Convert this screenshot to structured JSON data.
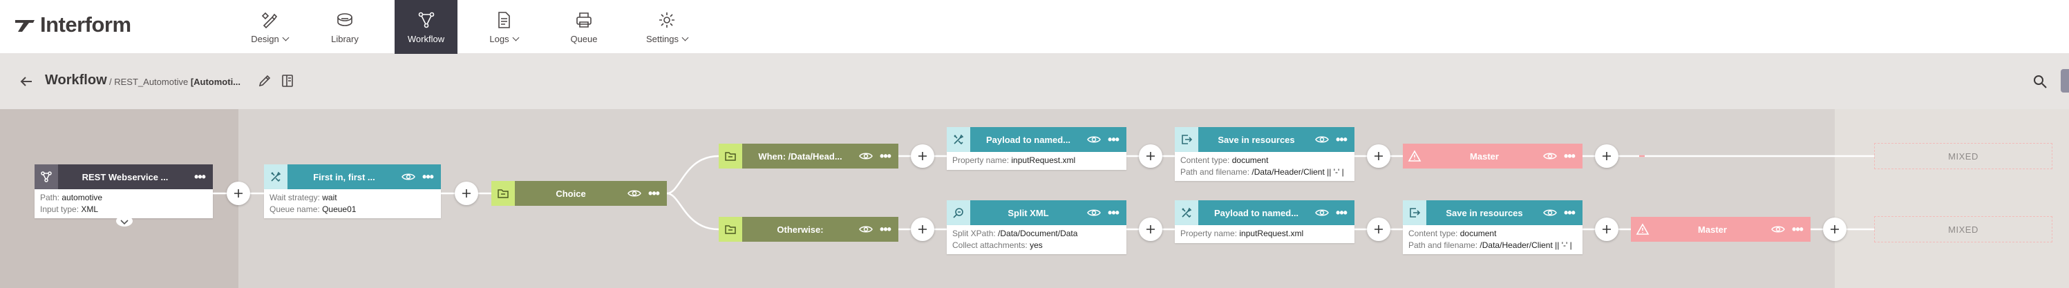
{
  "app": {
    "brand": "Interform"
  },
  "nav": [
    {
      "label": "Design",
      "has_menu": true,
      "icon": "design-icon",
      "active": false
    },
    {
      "label": "Library",
      "has_menu": false,
      "icon": "library-icon",
      "active": false
    },
    {
      "label": "Workflow",
      "has_menu": false,
      "icon": "workflow-icon",
      "active": true
    },
    {
      "label": "Logs",
      "has_menu": true,
      "icon": "logs-icon",
      "active": false
    },
    {
      "label": "Queue",
      "has_menu": false,
      "icon": "queue-icon",
      "active": false
    },
    {
      "label": "Settings",
      "has_menu": true,
      "icon": "settings-icon",
      "active": false
    }
  ],
  "header": {
    "title": "Workflow",
    "breadcrumb_sep": "/",
    "breadcrumb_name": "REST_Automotive",
    "breadcrumb_bold": "[Automoti..."
  },
  "colors": {
    "brand": "#3f3b3b",
    "nav_active": "#3b3a45",
    "input_node": "#45424d",
    "action_node": "#3d9fad",
    "action_icon": "#c9ecef",
    "choice_node": "#838e59",
    "choice_icon": "#cde87a",
    "master_node": "#f6a2a6",
    "canvas": "#d8d3d0"
  },
  "nodes": {
    "rest": {
      "title": "REST Webservice ...",
      "details": [
        {
          "label": "Path:",
          "value": "automotive"
        },
        {
          "label": "Input type:",
          "value": "XML"
        }
      ]
    },
    "firstin": {
      "title": "First in, first ...",
      "details": [
        {
          "label": "Wait strategy:",
          "value": "wait"
        },
        {
          "label": "Queue name:",
          "value": "Queue01"
        }
      ]
    },
    "choice": {
      "title": "Choice"
    },
    "when": {
      "title": "When: /Data/Head..."
    },
    "otherwise": {
      "title": "Otherwise:"
    },
    "payload1": {
      "title": "Payload to named...",
      "details": [
        {
          "label": "Property name:",
          "value": "inputRequest.xml"
        }
      ]
    },
    "save1": {
      "title": "Save in resources",
      "details": [
        {
          "label": "Content type:",
          "value": "document"
        },
        {
          "label": "Path and filename:",
          "value": "/Data/Header/Client || '-' |"
        }
      ]
    },
    "master1": {
      "title": "Master"
    },
    "split": {
      "title": "Split XML",
      "details": [
        {
          "label": "Split XPath:",
          "value": "/Data/Document/Data"
        },
        {
          "label": "Collect attachments:",
          "value": "yes"
        }
      ]
    },
    "payload2": {
      "title": "Payload to named...",
      "details": [
        {
          "label": "Property name:",
          "value": "inputRequest.xml"
        }
      ]
    },
    "save2": {
      "title": "Save in resources",
      "details": [
        {
          "label": "Content type:",
          "value": "document"
        },
        {
          "label": "Path and filename:",
          "value": "/Data/Header/Client || '-' |"
        }
      ]
    },
    "master2": {
      "title": "Master"
    }
  },
  "mixed": [
    "MIXED",
    "MIXED"
  ]
}
